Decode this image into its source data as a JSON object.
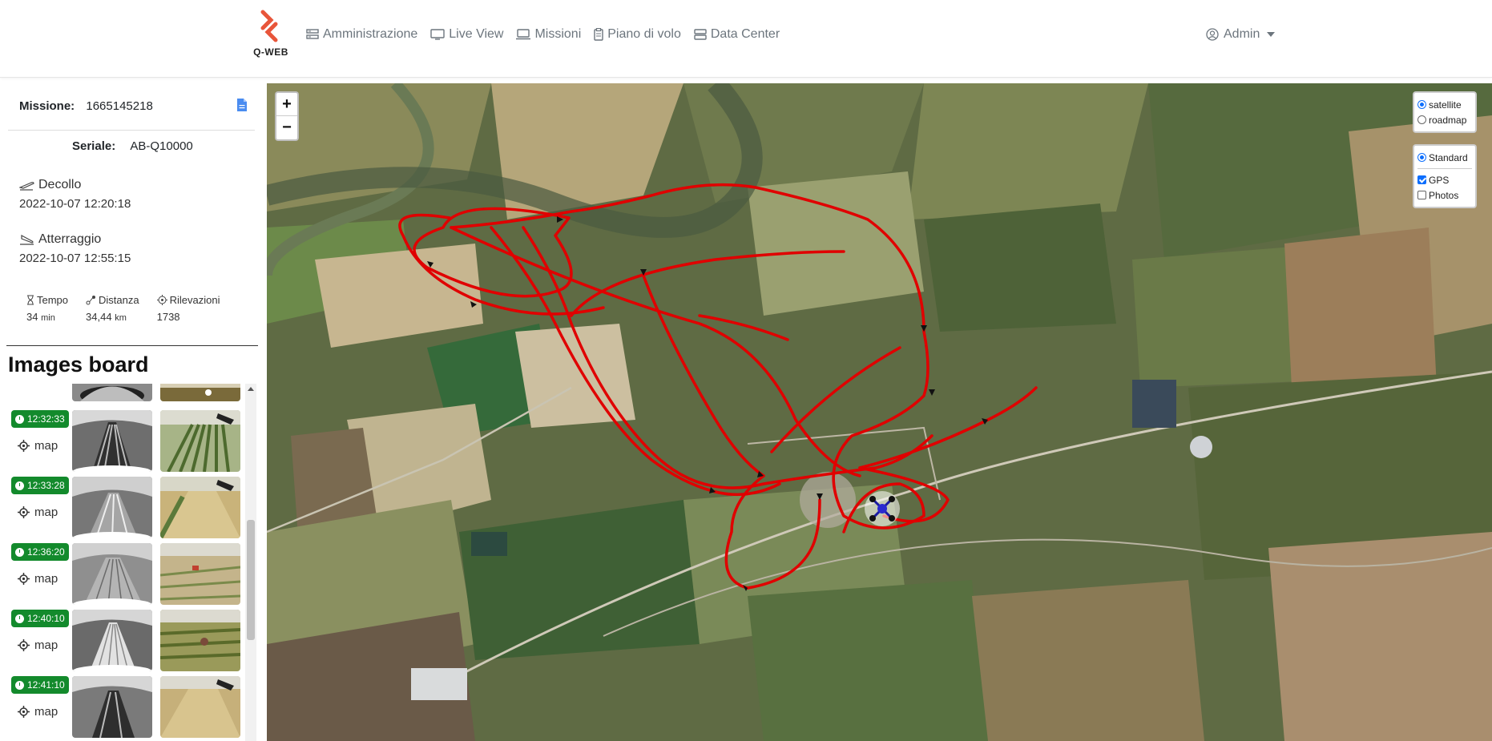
{
  "app": {
    "brand": "Q-WEB"
  },
  "nav": {
    "items": [
      {
        "label": "Amministrazione",
        "icon": "server-icon"
      },
      {
        "label": "Live View",
        "icon": "monitor-icon"
      },
      {
        "label": "Missioni",
        "icon": "laptop-icon"
      },
      {
        "label": "Piano di volo",
        "icon": "clipboard-icon"
      },
      {
        "label": "Data Center",
        "icon": "database-icon"
      }
    ],
    "user": "Admin"
  },
  "mission": {
    "label": "Missione:",
    "id": "1665145218",
    "serial_label": "Seriale:",
    "serial": "AB-Q10000",
    "takeoff_label": "Decollo",
    "takeoff_time": "2022-10-07 12:20:18",
    "landing_label": "Atterraggio",
    "landing_time": "2022-10-07 12:55:15",
    "stats": {
      "time_label": "Tempo",
      "time_value": "34",
      "time_unit": "min",
      "distance_label": "Distanza",
      "distance_value": "34,44",
      "distance_unit": "km",
      "detections_label": "Rilevazioni",
      "detections_value": "1738"
    }
  },
  "images_board": {
    "title": "Images board",
    "map_label": "map",
    "items": [
      {
        "time": "12:32:33"
      },
      {
        "time": "12:33:28"
      },
      {
        "time": "12:36:20"
      },
      {
        "time": "12:40:10"
      },
      {
        "time": "12:41:10"
      }
    ]
  },
  "map_controls": {
    "zoom_in": "+",
    "zoom_out": "−",
    "base_layers": [
      {
        "label": "satellite",
        "selected": true
      },
      {
        "label": "roadmap",
        "selected": false
      }
    ],
    "overlay_base": {
      "label": "Standard",
      "selected": true
    },
    "overlays": [
      {
        "label": "GPS",
        "checked": true
      },
      {
        "label": "Photos",
        "checked": false
      }
    ]
  },
  "colors": {
    "track": "#e00000",
    "badge": "#138a2c",
    "accent": "#0d6efd",
    "logo": "#e8553a"
  }
}
